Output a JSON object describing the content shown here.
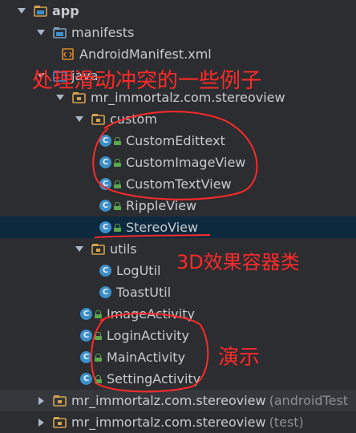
{
  "tree": [
    {
      "id": "app",
      "label": "app",
      "icon": "module-folder-icon",
      "arrow": "expanded",
      "depth": 0,
      "bold": true
    },
    {
      "id": "manifests",
      "label": "manifests",
      "icon": "folder-icon",
      "arrow": "expanded",
      "depth": 1
    },
    {
      "id": "android-manifest",
      "label": "AndroidManifest.xml",
      "icon": "xml-file-icon",
      "arrow": "none",
      "depth": 2
    },
    {
      "id": "java",
      "label": "java",
      "icon": "source-folder-icon",
      "arrow": "expanded",
      "depth": 1
    },
    {
      "id": "pkg-main",
      "label": "mr_immortalz.com.stereoview",
      "icon": "package-icon",
      "arrow": "expanded",
      "depth": 2
    },
    {
      "id": "custom",
      "label": "custom",
      "icon": "package-icon",
      "arrow": "expanded",
      "depth": 3
    },
    {
      "id": "custom-edittext",
      "label": "CustomEdittext",
      "icon": "class-icon",
      "arrow": "none",
      "depth": 4,
      "lock": true
    },
    {
      "id": "custom-imageview",
      "label": "CustomImageView",
      "icon": "class-icon",
      "arrow": "none",
      "depth": 4,
      "lock": true
    },
    {
      "id": "custom-textview",
      "label": "CustomTextView",
      "icon": "class-icon",
      "arrow": "none",
      "depth": 4,
      "lock": true
    },
    {
      "id": "rippleview",
      "label": "RippleView",
      "icon": "class-icon",
      "arrow": "none",
      "depth": 4,
      "lock": true
    },
    {
      "id": "stereoview",
      "label": "StereoView",
      "icon": "class-icon",
      "arrow": "none",
      "depth": 4,
      "lock": true,
      "selected": true
    },
    {
      "id": "utils",
      "label": "utils",
      "icon": "package-icon",
      "arrow": "expanded",
      "depth": 3
    },
    {
      "id": "logutil",
      "label": "LogUtil",
      "icon": "class-icon",
      "arrow": "none",
      "depth": 4
    },
    {
      "id": "toastutil",
      "label": "ToastUtil",
      "icon": "class-icon",
      "arrow": "none",
      "depth": 4
    },
    {
      "id": "imageactivity",
      "label": "ImageActivity",
      "icon": "class-icon",
      "arrow": "none",
      "depth": 3,
      "lock": true
    },
    {
      "id": "loginactivity",
      "label": "LoginActivity",
      "icon": "class-icon",
      "arrow": "none",
      "depth": 3,
      "lock": true
    },
    {
      "id": "mainactivity",
      "label": "MainActivity",
      "icon": "class-icon",
      "arrow": "none",
      "depth": 3,
      "lock": true
    },
    {
      "id": "settingactivity",
      "label": "SettingActivity",
      "icon": "class-icon",
      "arrow": "none",
      "depth": 3,
      "lock": true
    },
    {
      "id": "pkg-androidtest",
      "label": "mr_immortalz.com.stereoview",
      "suffix": "(androidTest",
      "icon": "package-icon",
      "arrow": "collapsed",
      "depth": 1,
      "dim": true
    },
    {
      "id": "pkg-test",
      "label": "mr_immortalz.com.stereoview",
      "suffix": "(test)",
      "icon": "package-icon",
      "arrow": "collapsed",
      "depth": 1
    }
  ],
  "class_icon_letter": "C",
  "annotations": {
    "slide_conflict": "处理滑动冲突的一些例子",
    "container_3d": "3D效果容器类",
    "demo": "演示"
  },
  "colors": {
    "annotation": "#ff2a2a",
    "selected_row": "#0d293e",
    "folder": "#7f9fbf",
    "package": "#d4a24c",
    "class_icon": "#3d8fc9",
    "lock": "#5aa84b"
  }
}
